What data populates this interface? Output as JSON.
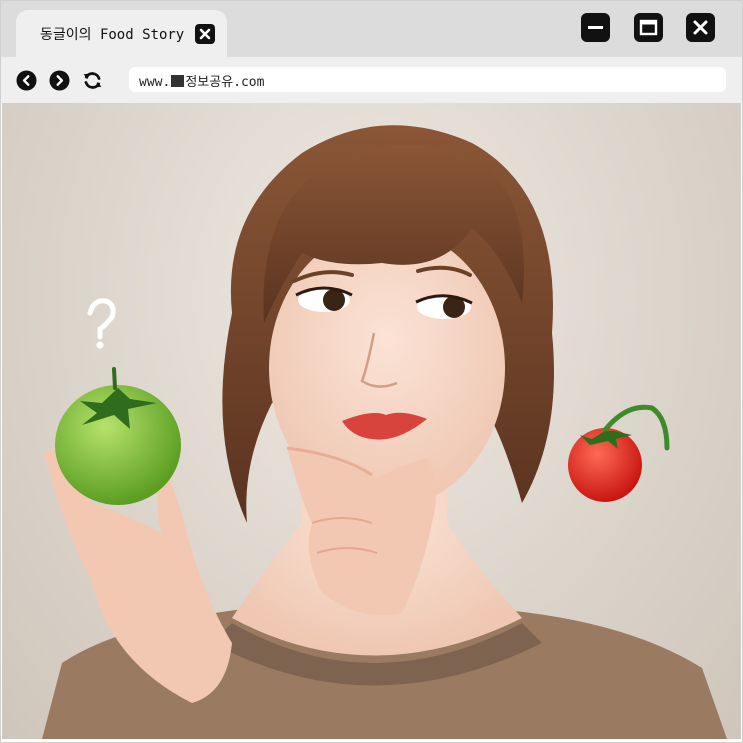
{
  "tab": {
    "title": "동글이의 Food Story"
  },
  "address_bar": {
    "url_prefix": "www.",
    "url_suffix": "정보공유.com"
  },
  "icons": {
    "tab_close": "close-icon",
    "minimize": "minimize-icon",
    "maximize": "maximize-icon",
    "close": "close-icon",
    "back": "chevron-left-icon",
    "forward": "chevron-right-icon",
    "reload": "refresh-icon",
    "site": "site-favicon"
  },
  "colors": {
    "tabbar": "#dcdcdc",
    "tab": "#efefef",
    "toolbar": "#efefef",
    "icon": "#111111",
    "green_tomato": "#7cc13a",
    "red_tomato": "#e0231c",
    "shirt": "#9a7b62"
  }
}
